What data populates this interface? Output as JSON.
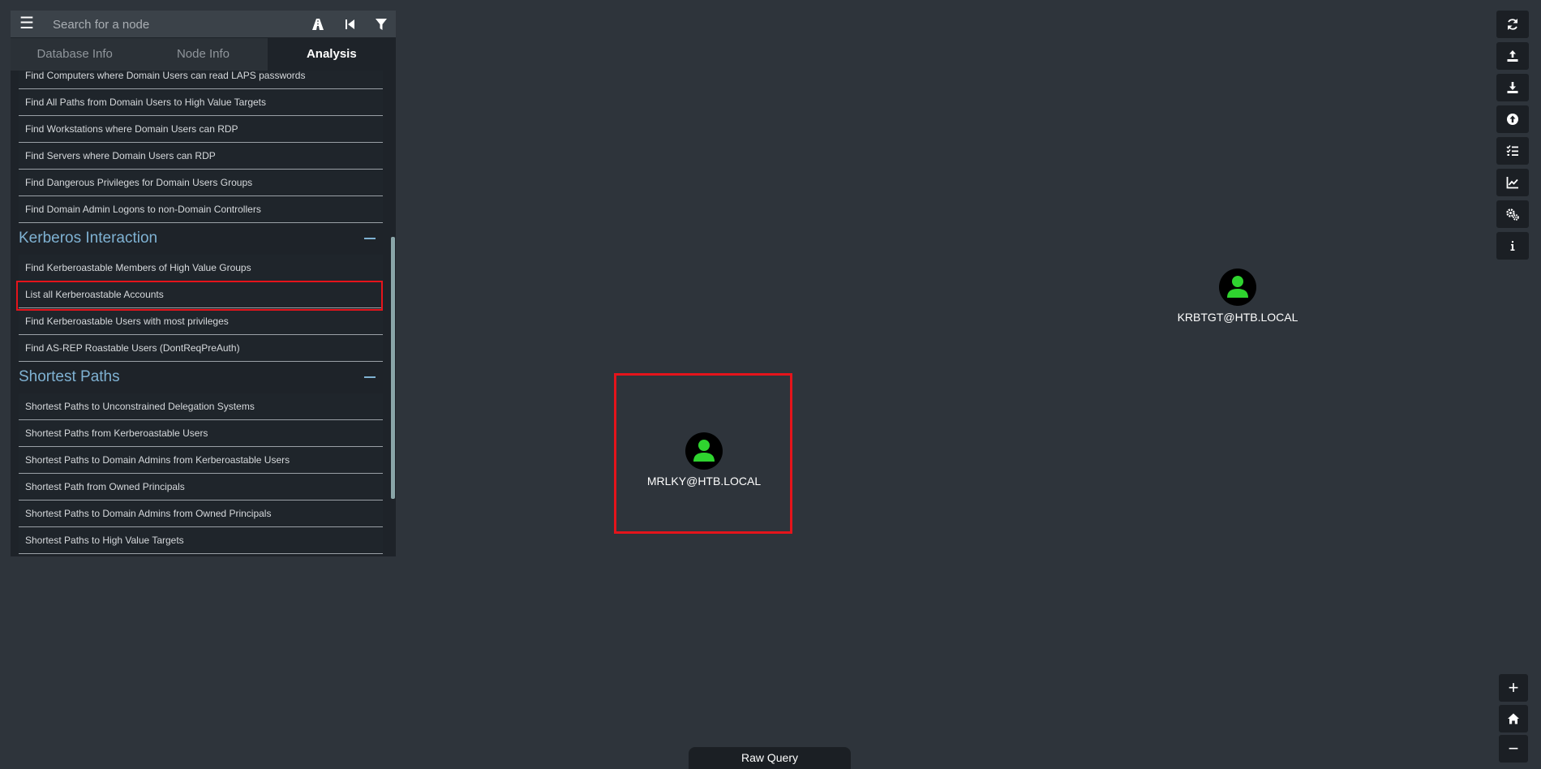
{
  "search": {
    "placeholder": "Search for a node"
  },
  "toolbar_icons": [
    "menu-icon",
    "pathfinding-icon",
    "back-icon",
    "filter-icon"
  ],
  "tabs": [
    {
      "label": "Database Info",
      "active": false
    },
    {
      "label": "Node Info",
      "active": false
    },
    {
      "label": "Analysis",
      "active": true
    }
  ],
  "analysis": {
    "top_queries": [
      "Find Computers where Domain Users can read LAPS passwords",
      "Find All Paths from Domain Users to High Value Targets",
      "Find Workstations where Domain Users can RDP",
      "Find Servers where Domain Users can RDP",
      "Find Dangerous Privileges for Domain Users Groups",
      "Find Domain Admin Logons to non-Domain Controllers"
    ],
    "sections": [
      {
        "title": "Kerberos Interaction",
        "queries": [
          "Find Kerberoastable Members of High Value Groups",
          "List all Kerberoastable Accounts",
          "Find Kerberoastable Users with most privileges",
          "Find AS-REP Roastable Users (DontReqPreAuth)"
        ]
      },
      {
        "title": "Shortest Paths",
        "queries": [
          "Shortest Paths to Unconstrained Delegation Systems",
          "Shortest Paths from Kerberoastable Users",
          "Shortest Paths to Domain Admins from Kerberoastable Users",
          "Shortest Path from Owned Principals",
          "Shortest Paths to Domain Admins from Owned Principals",
          "Shortest Paths to High Value Targets"
        ]
      }
    ]
  },
  "graph": {
    "nodes": [
      {
        "label": "KRBTGT@HTB.LOCAL",
        "icon": "user-icon"
      },
      {
        "label": "MRLKY@HTB.LOCAL",
        "icon": "user-icon"
      }
    ]
  },
  "right_toolbar": [
    "refresh-icon",
    "export-icon",
    "import-icon",
    "upload-icon",
    "queries-icon",
    "chart-icon",
    "settings-icon",
    "info-icon"
  ],
  "zoom": {
    "in": "+",
    "out": "−"
  },
  "raw_query": {
    "label": "Raw Query"
  },
  "colors": {
    "background": "#2e343b",
    "panel": "#1e2329",
    "node_icon": "#2fd42f",
    "highlight": "#e5141b",
    "section_title": "#7fb2d3"
  }
}
